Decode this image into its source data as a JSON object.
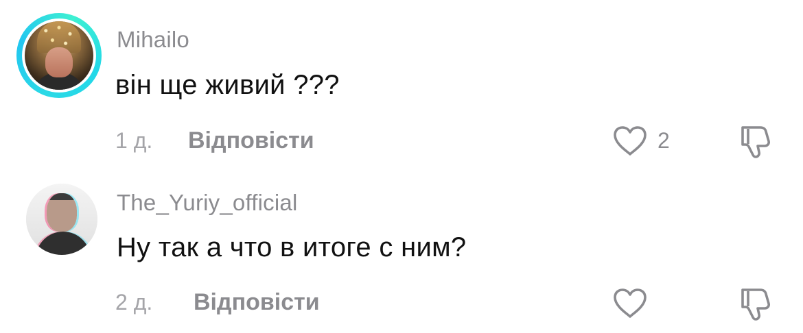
{
  "comments": [
    {
      "username": "Mihailo",
      "text": "він ще живий ???",
      "time": "1 д.",
      "reply_label": "Відповісти",
      "like_count": "2",
      "avatar_ring_color": "#2bd9e6"
    },
    {
      "username": "The_Yuriy_official",
      "text": "Ну так а что в итоге с ним?",
      "time": "2 д.",
      "reply_label": "Відповісти",
      "like_count": ""
    }
  ],
  "icons": {
    "like": "heart-outline-icon",
    "dislike": "thumbs-down-outline-icon"
  },
  "colors": {
    "username": "#8b8b8f",
    "text": "#111111",
    "meta": "#a4a4a8"
  }
}
